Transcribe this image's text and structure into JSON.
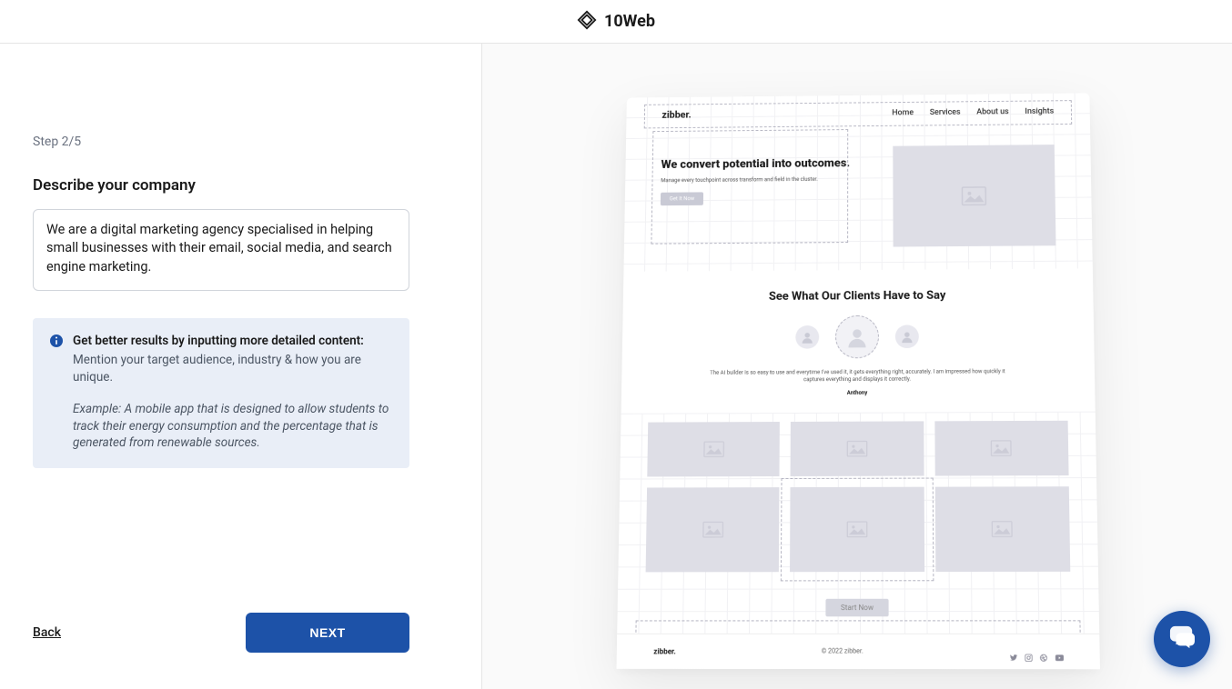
{
  "header": {
    "brand": "10Web"
  },
  "wizard": {
    "step_label": "Step 2/5",
    "title": "Describe your company",
    "description_value": "We are a digital marketing agency specialised in helping small businesses with their email, social media, and search engine marketing.",
    "info": {
      "title": "Get better results by inputting more detailed content:",
      "line": "Mention your target audience, industry & how you are unique.",
      "example": "Example: A mobile app that is designed to allow students to track their energy consumption and the percentage that is generated from renewable sources."
    },
    "back_label": "Back",
    "next_label": "NEXT"
  },
  "preview": {
    "brand": "zibber.",
    "nav": [
      "Home",
      "Services",
      "About us",
      "Insights"
    ],
    "hero": {
      "title": "We convert potential into outcomes.",
      "subtitle": "Manage every touchpoint across transform and field in the cluster.",
      "cta": "Get It Now"
    },
    "testimonials": {
      "title": "See What Our Clients Have to Say",
      "quote": "The AI builder is so easy to use and everytime I've used it, it gets everything right, accurately. I am impressed how quickly it captures everything and displays it correctly.",
      "author": "Anthony"
    },
    "cta2": "Start Now",
    "footer": {
      "brand": "zibber.",
      "copyright": "© 2022 zibber."
    }
  }
}
